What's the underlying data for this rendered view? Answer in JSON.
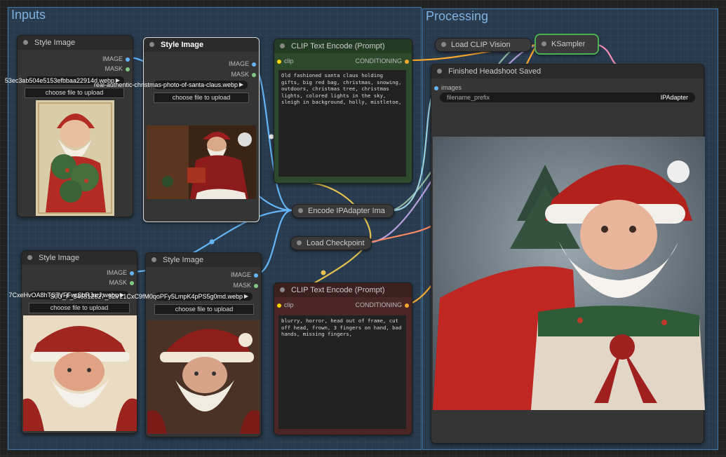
{
  "groups": [
    {
      "title": "Inputs",
      "color": "#3f7cab"
    },
    {
      "title": "Processing",
      "color": "#3f7cab"
    }
  ],
  "style_nodes": [
    {
      "title": "Style Image",
      "out_image": "IMAGE",
      "out_mask": "MASK",
      "file": "53ec3ab504e5153efbbaa22914d.webp",
      "upload": "choose file to upload"
    },
    {
      "title": "Style Image",
      "out_image": "IMAGE",
      "out_mask": "MASK",
      "file": "real-authentic-christmas-photo-of-santa-claus.webp",
      "upload": "choose file to upload"
    },
    {
      "title": "Style Image",
      "out_image": "IMAGE",
      "out_mask": "MASK",
      "file": "7CxeHvOA8hTS7VFFwrSbRJnrJ.webp",
      "upload": "choose file to upload"
    },
    {
      "title": "Style Image",
      "out_image": "IMAGE",
      "out_mask": "MASK",
      "file": "S0U_F_346512627_32V21CxC9fM0qoPFy5LmpK4pPS5g0md.webp",
      "upload": "choose file to upload"
    }
  ],
  "clip_pos": {
    "title": "CLIP Text Encode (Prompt)",
    "in_clip": "clip",
    "out": "CONDITIONING",
    "text": "Old fashioned santa claus holding gifts, big red bag, christmas, snowing, outdoors, christmas tree, christmas lights, colored lights in the sky, sleigh in background, holly, mistletoe,"
  },
  "clip_neg": {
    "title": "CLIP Text Encode (Prompt)",
    "in_clip": "clip",
    "out": "CONDITIONING",
    "text": "blurry, horror, head out of frame, cut off head, frown, 3 fingers on hand, bad hands, missing fingers,"
  },
  "encode_ipadapter": {
    "title": "Encode IPAdapter Ima"
  },
  "load_checkpoint": {
    "title": "Load Checkpoint"
  },
  "load_clip_vision": {
    "title": "Load CLIP Vision"
  },
  "ksampler": {
    "title": "KSampler"
  },
  "finished": {
    "title": "Finished Headshoot Saved",
    "in_images": "images",
    "prefix_label": "filename_prefix",
    "prefix_value": "IPAdapter"
  },
  "colors": {
    "image_slot": "#64b5f6",
    "mask_slot": "#81c784",
    "clip_slot": "#ffd500",
    "conditioning_slot": "#ffa931",
    "clip_node_green": "#2d4a2d",
    "clip_node_red": "#4a2626"
  }
}
